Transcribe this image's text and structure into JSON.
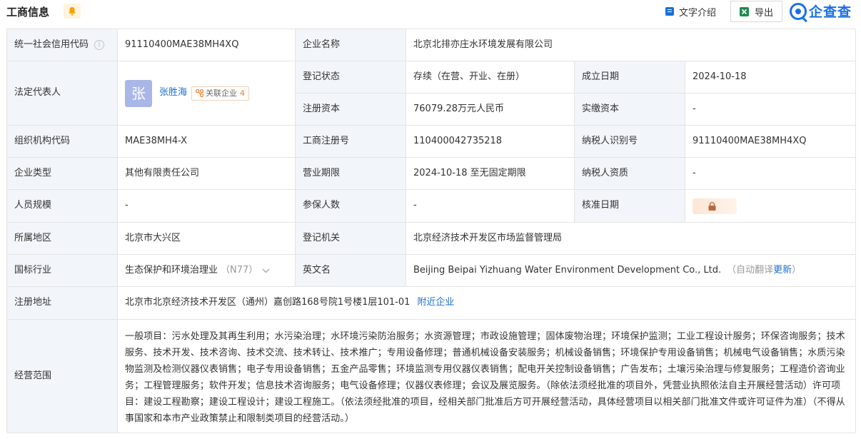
{
  "header": {
    "title": "工商信息",
    "text_intro_label": "文字介绍",
    "export_label": "导出",
    "brand_label": "企查查"
  },
  "fields": {
    "credit_code_label": "统一社会信用代码",
    "credit_code": "91110400MAE38MH4XQ",
    "company_name_label": "企业名称",
    "company_name": "北京北排亦庄水环境发展有限公司",
    "legal_rep_label": "法定代表人",
    "legal_rep_avatar": "张",
    "legal_rep_name": "张胜海",
    "related_label": "关联企业",
    "related_count": "4",
    "reg_status_label": "登记状态",
    "reg_status": "存续（在营、开业、在册）",
    "found_date_label": "成立日期",
    "found_date": "2024-10-18",
    "reg_capital_label": "注册资本",
    "reg_capital": "76079.28万元人民币",
    "paid_capital_label": "实缴资本",
    "paid_capital": "-",
    "org_code_label": "组织机构代码",
    "org_code": "MAE38MH4-X",
    "biz_reg_no_label": "工商注册号",
    "biz_reg_no": "110400042735218",
    "taxpayer_id_label": "纳税人识别号",
    "taxpayer_id": "91110400MAE38MH4XQ",
    "company_type_label": "企业类型",
    "company_type": "其他有限责任公司",
    "biz_term_label": "营业期限",
    "biz_term": "2024-10-18 至无固定期限",
    "taxpayer_qual_label": "纳税人资质",
    "taxpayer_qual": "-",
    "staff_size_label": "人员规模",
    "staff_size": "-",
    "insured_label": "参保人数",
    "insured": "-",
    "approval_date_label": "核准日期",
    "region_label": "所属地区",
    "region": "北京市大兴区",
    "authority_label": "登记机关",
    "authority": "北京经济技术开发区市场监督管理局",
    "industry_label": "国标行业",
    "industry": "生态保护和环境治理业",
    "industry_code": "（N77）",
    "english_name_label": "英文名",
    "english_name": "Beijing Beipai Yizhuang Water Environment Development Co., Ltd.",
    "auto_translate": "（自动翻译",
    "update_label": "更新",
    "auto_translate_end": "）",
    "address_label": "注册地址",
    "address": "北京市北京经济技术开发区（通州）嘉创路168号院1号楼1层101-01",
    "nearby_label": "附近企业",
    "scope_label": "经营范围",
    "scope": "一般项目：污水处理及其再生利用；水污染治理；水环境污染防治服务；水资源管理；市政设施管理；固体废物治理；环境保护监测；工业工程设计服务；环保咨询服务；技术服务、技术开发、技术咨询、技术交流、技术转让、技术推广；专用设备修理；普通机械设备安装服务；机械设备销售；环境保护专用设备销售；机械电气设备销售；水质污染物监测及检测仪器仪表销售；电子专用设备销售；五金产品零售；环境监测专用仪器仪表销售；配电开关控制设备销售；广告发布；土壤污染治理与修复服务；工程造价咨询业务；工程管理服务；软件开发；信息技术咨询服务；电气设备修理；仪器仪表修理；会议及展览服务。（除依法须经批准的项目外，凭营业执照依法自主开展经营活动）许可项目：建设工程勘察；建设工程设计；建设工程施工。（依法须经批准的项目，经相关部门批准后方可开展经营活动，具体经营项目以相关部门批准文件或许可证件为准）（不得从事国家和本市产业政策禁止和限制类项目的经营活动。）"
  },
  "colors": {
    "label_bg": "#f2f5fa",
    "border": "#e4e4e4",
    "link": "#1a6fd1",
    "brand": "#1a6fe6",
    "accent_orange": "#ee7d2e"
  }
}
